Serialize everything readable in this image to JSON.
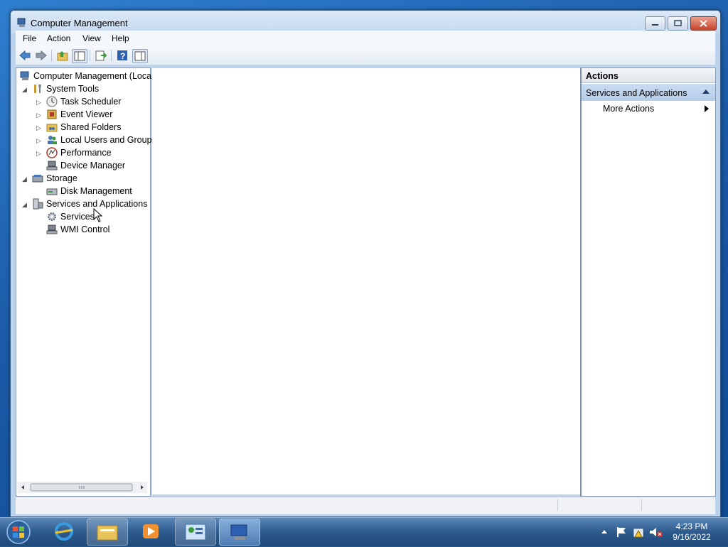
{
  "window": {
    "title": "Computer Management"
  },
  "menu": [
    "File",
    "Action",
    "View",
    "Help"
  ],
  "toolbar": {
    "icons": [
      "back-arrow-icon",
      "forward-arrow-icon",
      "up-folder-icon",
      "show-hide-tree-icon",
      "export-list-icon",
      "help-icon",
      "show-hide-action-pane-icon"
    ]
  },
  "tree": {
    "root": "Computer Management (Local",
    "system_tools": "System Tools",
    "task_scheduler": "Task Scheduler",
    "event_viewer": "Event Viewer",
    "shared_folders": "Shared Folders",
    "local_users": "Local Users and Groups",
    "performance": "Performance",
    "device_manager": "Device Manager",
    "storage": "Storage",
    "disk_management": "Disk Management",
    "services_apps": "Services and Applications",
    "services": "Services",
    "wmi_control": "WMI Control"
  },
  "actions": {
    "header": "Actions",
    "group": "Services and Applications",
    "more": "More Actions"
  },
  "taskbar": {
    "time": "4:23 PM",
    "date": "9/16/2022"
  }
}
